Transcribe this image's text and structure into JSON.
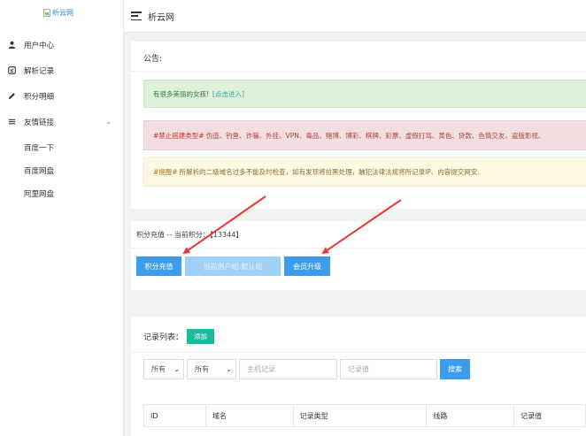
{
  "sidebar": {
    "logo_text": "析云网",
    "menu": [
      {
        "label": "用户中心",
        "icon": "user-icon"
      },
      {
        "label": "解析记录",
        "icon": "record-icon"
      },
      {
        "label": "积分明细",
        "icon": "pencil-icon"
      },
      {
        "label": "友情链接",
        "icon": "list-icon"
      }
    ],
    "submenu": [
      "百度一下",
      "百度网盘",
      "阿里网盘"
    ]
  },
  "topbar": {
    "title": "析云网"
  },
  "notice": {
    "heading": "公告:",
    "green_text": "有很多美丽的女孩!",
    "green_link": "[点击进入]",
    "red_tag": "#禁止搭建类型#",
    "red_text": "伪造、钓鱼、诈骗、外挂、VPN、毒品、赌博、博彩、棋牌、彩票、虚假打骂、黄色、贷款、色情交友、盗版影视、",
    "yellow_tag": "#提醒#",
    "yellow_text": "所解析的二级域名过多不能及时检查，如有发现将拉黑处理，触犯法律法规将所记录IP、内容提交网安."
  },
  "points": {
    "heading": "积分充值 -- 当前积分：【13344】",
    "recharge_label": "积分充值",
    "group_label": "当前用户组:默认组",
    "upgrade_label": "会员升级"
  },
  "records": {
    "heading": "记录列表：",
    "add_label": "添加",
    "filter1": "所有",
    "filter2": "所有",
    "host_placeholder": "主机记录",
    "value_placeholder": "记录值",
    "search_label": "搜索",
    "columns": [
      "ID",
      "域名",
      "记录类型",
      "线路",
      "记录值"
    ]
  },
  "colors": {
    "primary": "#3c9ded",
    "accent": "#1bbc9b",
    "arrow": "#e53935"
  }
}
